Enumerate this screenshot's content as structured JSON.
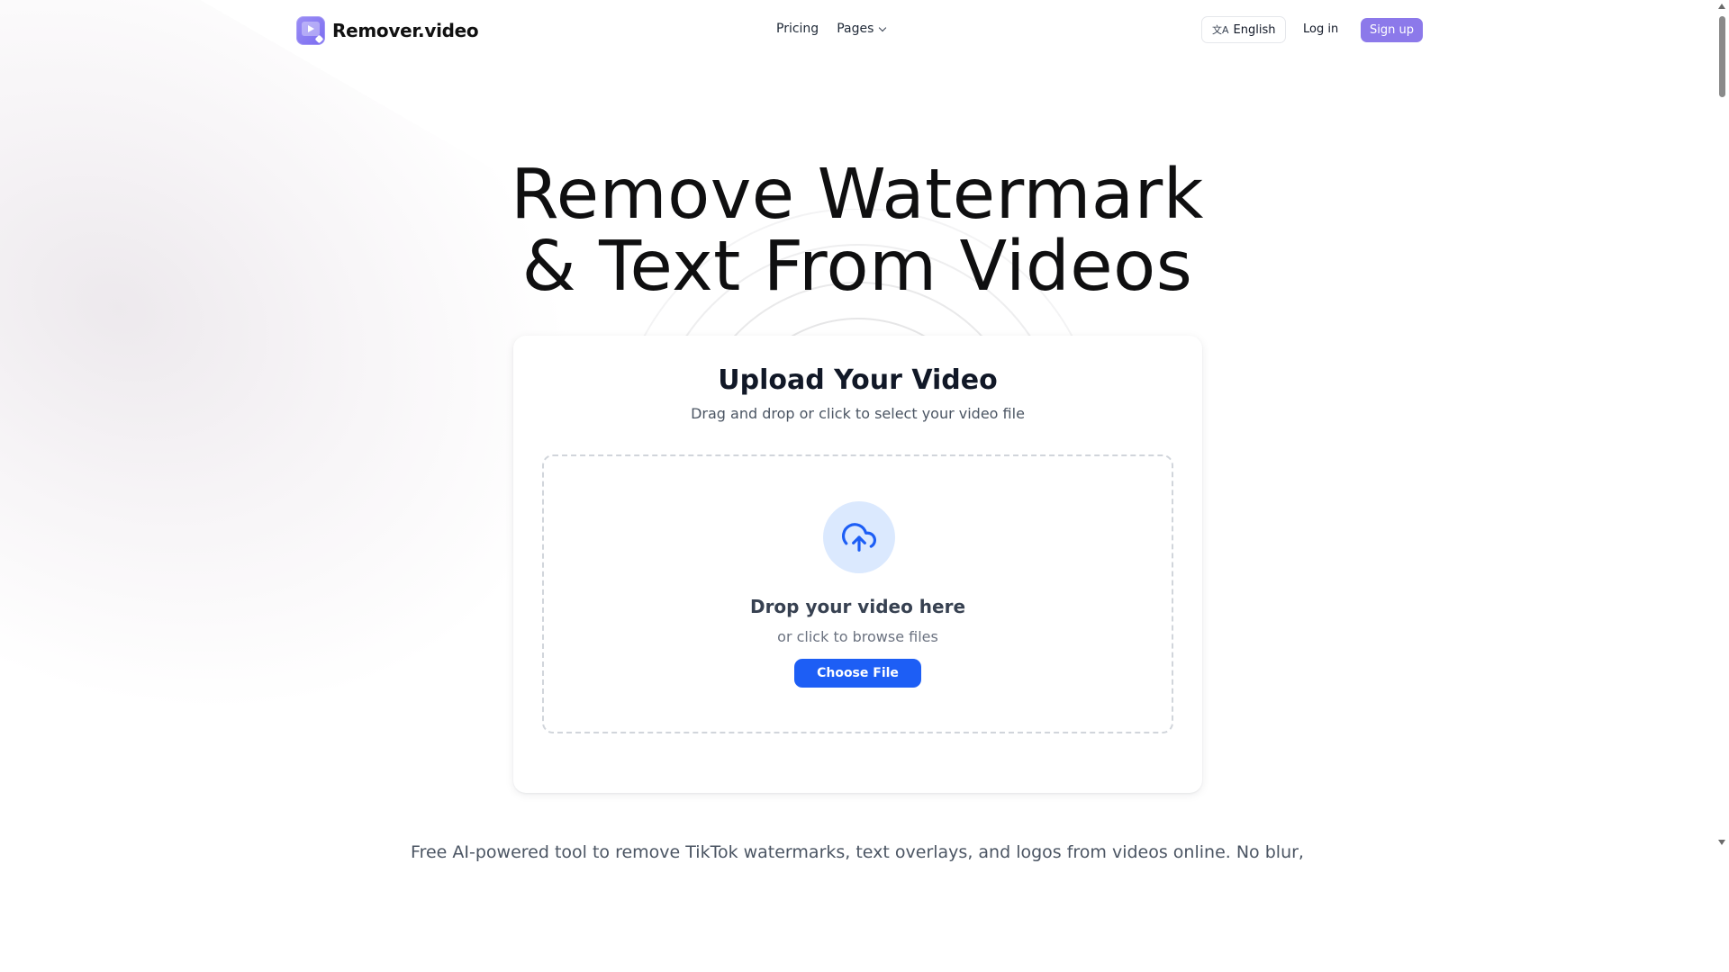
{
  "brand": {
    "name": "Remover.video"
  },
  "nav": {
    "pricing": "Pricing",
    "pages": "Pages"
  },
  "header_actions": {
    "language": "English",
    "login": "Log in",
    "signup": "Sign up"
  },
  "hero": {
    "line1": "Remove Watermark",
    "line2": "& Text From Videos"
  },
  "upload_card": {
    "title": "Upload Your Video",
    "subtitle": "Drag and drop or click to select your video file",
    "drop_title": "Drop your video here",
    "drop_subtitle": "or click to browse files",
    "button": "Choose File"
  },
  "tagline": "Free AI-powered tool to remove TikTok watermarks, text overlays, and logos from videos online. No blur,",
  "icons": {
    "logo": "video-play-wand-icon",
    "language": "translate-icon",
    "pages_dropdown": "chevron-down-icon",
    "upload": "cloud-upload-icon"
  },
  "colors": {
    "brand_accent": "#8c79ea",
    "primary_button": "#1d5ef5",
    "upload_circle_bg": "#dbe9fe",
    "upload_icon": "#1d5ef5"
  }
}
